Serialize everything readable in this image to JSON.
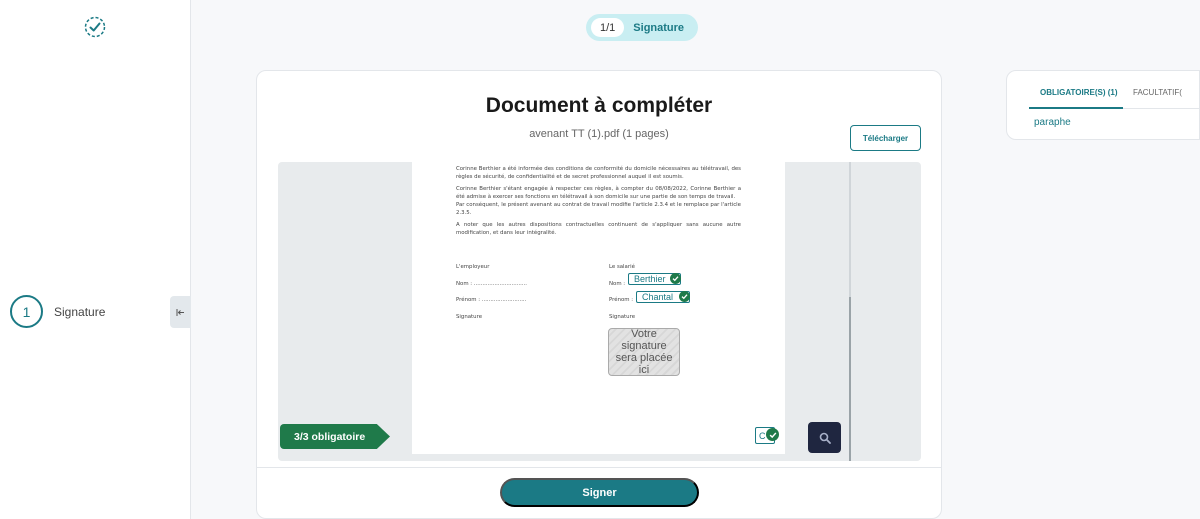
{
  "sidebar": {
    "step_number": "1",
    "step_label": "Signature"
  },
  "top_pill": {
    "count": "1/1",
    "label": "Signature"
  },
  "document": {
    "title": "Document à compléter",
    "subtitle": "avenant TT (1).pdf (1 pages)",
    "download_label": "Télécharger",
    "paragraphs": [
      "Corinne Berthier a été informée des conditions de conformité du domicile nécessaires au télétravail, des règles de sécurité, de confidentialité et de secret professionnel auquel il est soumis.",
      "Corinne Berthier s'étant engagée à respecter ces règles, à compter du 08/08/2022, Corinne Berthier a été admise à exercer ses fonctions en télétravail à son domicile sur une partie de son temps de travail.\nPar conséquent, le présent avenant au contrat de travail modifie l'article 2.3.4 et le remplace par l'article 2.3.5.",
      "A noter que les autres dispositions contractuelles continuent de s'appliquer sans aucune autre modification, et dans leur intégralité."
    ],
    "employer_label": "L'employeur",
    "employee_label": "Le salarié",
    "employer_nom": "Nom : ...............................",
    "employee_nom": "Nom :",
    "employer_prenom": "Prénom : ..........................",
    "employee_prenom": "Prénom :",
    "signature_left": "Signature",
    "signature_right": "Signature",
    "field_nom_value": "Berthier",
    "field_prenom_value": "Chantal",
    "signature_placeholder": "Votre signature sera placée ici",
    "initial_field_value": "C",
    "mandatory_status": "3/3 obligatoire"
  },
  "actions": {
    "sign_label": "Signer"
  },
  "right_panel": {
    "tab_required": "OBLIGATOIRE(S) (1)",
    "tab_optional": "FACULTATIF(",
    "required_item": "paraphe"
  },
  "colors": {
    "primary": "#1b7a85",
    "success": "#1f7a4a",
    "dark_button": "#1f2640",
    "pill_bg": "#c9eef2"
  },
  "icons": {
    "logo": "check-circle-icon",
    "collapse": "collapse-left-icon",
    "zoom": "magnifier-icon",
    "field_done": "check-icon"
  }
}
